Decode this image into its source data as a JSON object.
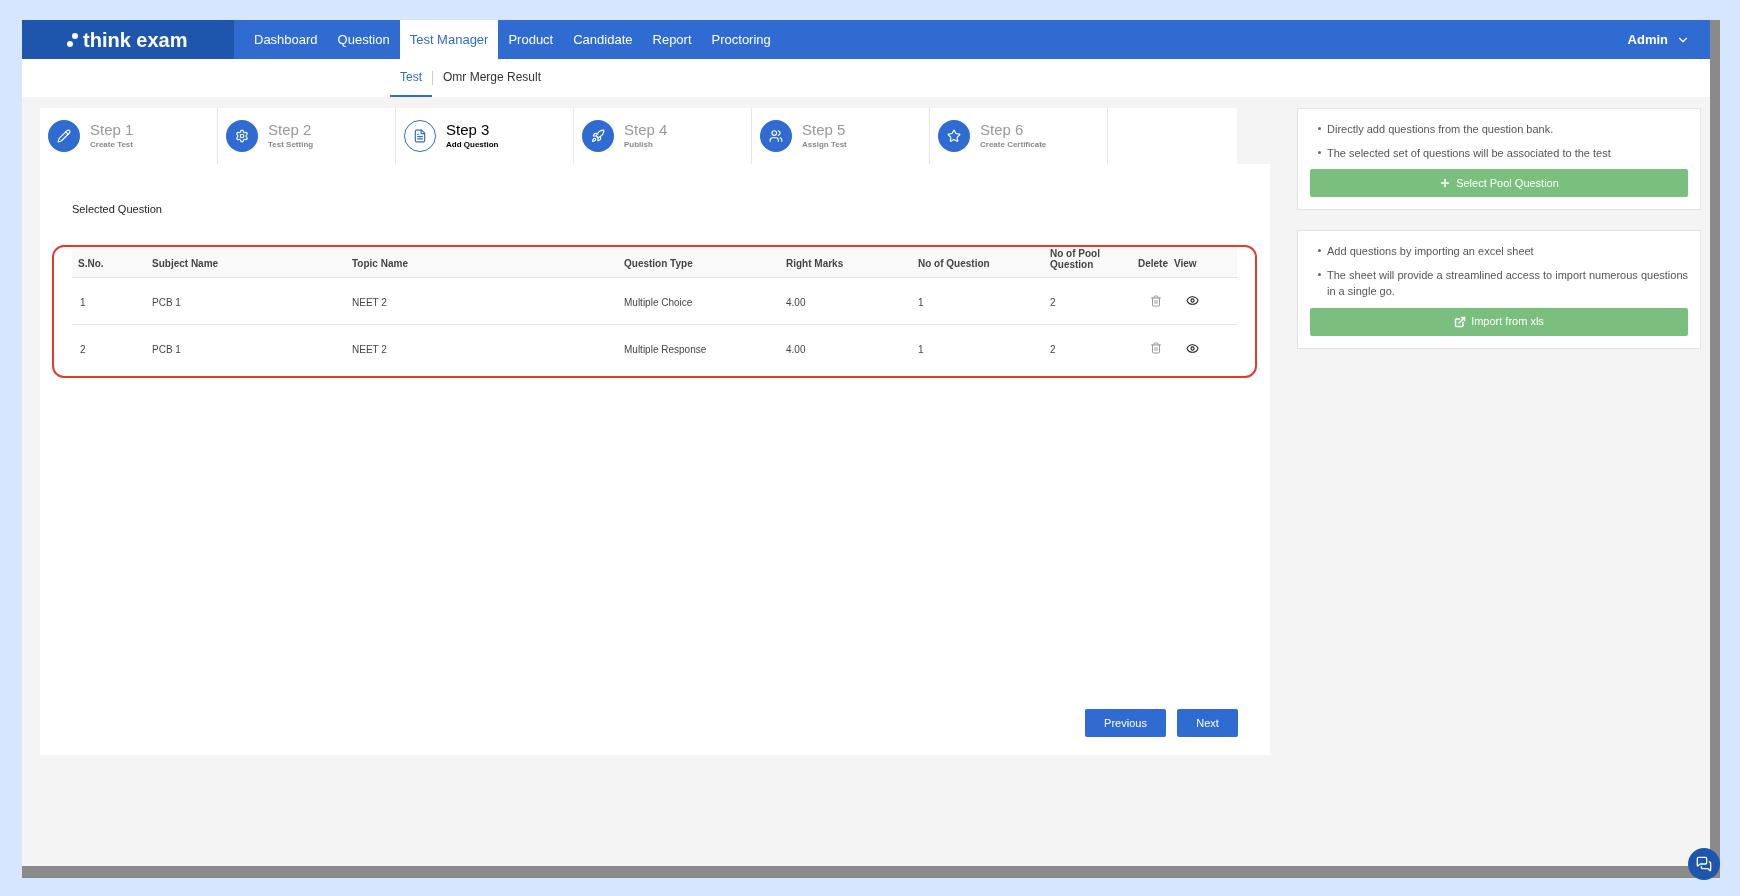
{
  "logo": "think exam",
  "nav": [
    {
      "label": "Dashboard",
      "selected": false
    },
    {
      "label": "Question",
      "selected": false
    },
    {
      "label": "Test Manager",
      "selected": true
    },
    {
      "label": "Product",
      "selected": false
    },
    {
      "label": "Candidate",
      "selected": false
    },
    {
      "label": "Report",
      "selected": false
    },
    {
      "label": "Proctoring",
      "selected": false
    }
  ],
  "user": "Admin",
  "subtabs": [
    {
      "label": "Test",
      "selected": true
    },
    {
      "label": "Omr Merge Result",
      "selected": false
    }
  ],
  "steps": [
    {
      "kind": "pencil",
      "title": "Step 1",
      "subtitle": "Create Test",
      "selected": false
    },
    {
      "kind": "gear",
      "title": "Step 2",
      "subtitle": "Test Setting",
      "selected": false
    },
    {
      "kind": "file",
      "title": "Step 3",
      "subtitle": "Add Question",
      "selected": true
    },
    {
      "kind": "rocket",
      "title": "Step 4",
      "subtitle": "Publish",
      "selected": false
    },
    {
      "kind": "users",
      "title": "Step 5",
      "subtitle": "Assign Test",
      "selected": false
    },
    {
      "kind": "star",
      "title": "Step 6",
      "subtitle": "Create Certificate",
      "selected": false
    }
  ],
  "section_title": "Selected Question",
  "table": {
    "columns": [
      "S.No.",
      "Subject Name",
      "Topic Name",
      "Question Type",
      "Right Marks",
      "No of Question",
      "No of Pool Question",
      "Delete",
      "View"
    ],
    "rows": [
      [
        "1",
        "PCB 1",
        "NEET 2",
        "Multiple Choice",
        "4.00",
        "1",
        "2"
      ],
      [
        "2",
        "PCB 1",
        "NEET 2",
        "Multiple Response",
        "4.00",
        "1",
        "2"
      ]
    ]
  },
  "buttons": [
    "Previous",
    "Next"
  ],
  "side_cards": [
    {
      "kind": "plus",
      "bullets": [
        "Directly add questions from the question bank.",
        "The selected set of questions will be associated to the test"
      ],
      "button": "Select Pool Question"
    },
    {
      "kind": "import",
      "bullets": [
        "Add questions by importing an excel sheet",
        "The sheet will provide a streamlined access to import numerous questions in a single go."
      ],
      "button": "Import from xls"
    }
  ]
}
